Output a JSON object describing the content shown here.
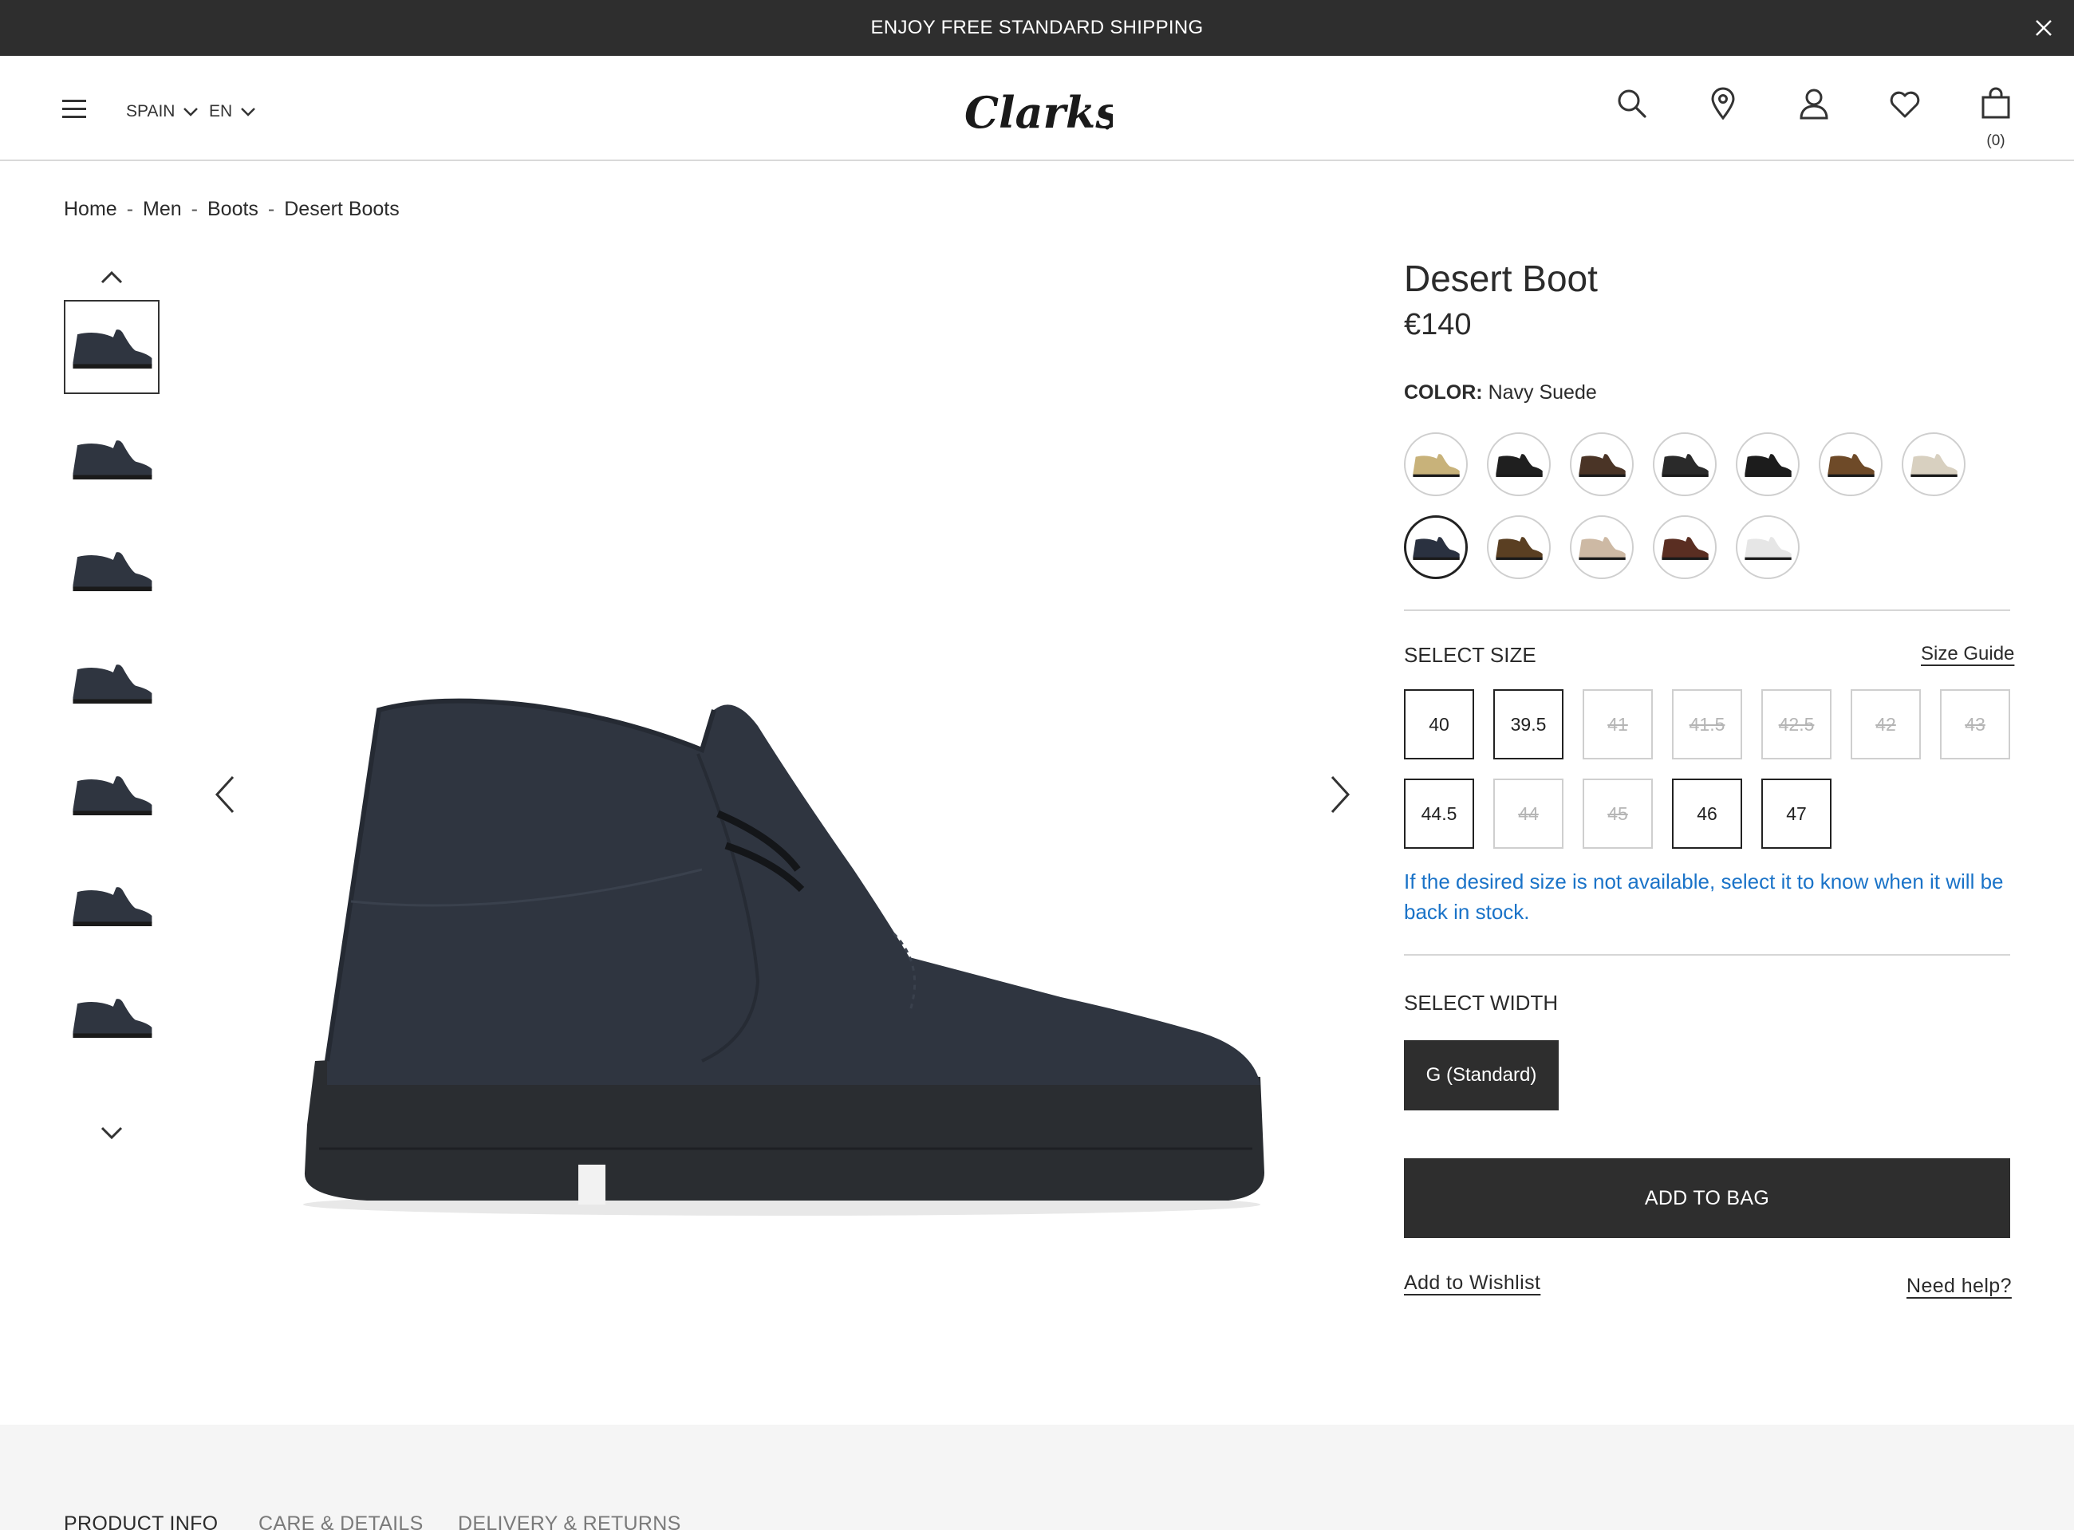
{
  "promo": {
    "text": "ENJOY FREE STANDARD SHIPPING"
  },
  "header": {
    "country": "SPAIN",
    "language": "EN",
    "logo_text": "Clarks",
    "bag_count": "(0)"
  },
  "breadcrumb": {
    "items": [
      "Home",
      "Men",
      "Boots",
      "Desert Boots"
    ],
    "separator": "-"
  },
  "product": {
    "title": "Desert Boot",
    "price": "€140",
    "color_label": "COLOR:",
    "color_value": "Navy Suede",
    "swatch_colors": [
      "#c8b27a",
      "#1f1f1f",
      "#4a3426",
      "#2a2a2a",
      "#1c1c1c",
      "#6e4a28",
      "#d8d0c0",
      "#2a3140",
      "#5a3f22",
      "#cdb9a4",
      "#5a2e22",
      "#e6e6e6"
    ],
    "selected_swatch_index": 7,
    "main_color": "#2f3540"
  },
  "size": {
    "label": "SELECT SIZE",
    "guide_link": "Size Guide",
    "options": [
      {
        "label": "40",
        "available": true
      },
      {
        "label": "39.5",
        "available": true
      },
      {
        "label": "41",
        "available": false
      },
      {
        "label": "41.5",
        "available": false
      },
      {
        "label": "42.5",
        "available": false
      },
      {
        "label": "42",
        "available": false
      },
      {
        "label": "43",
        "available": false
      },
      {
        "label": "44.5",
        "available": true
      },
      {
        "label": "44",
        "available": false
      },
      {
        "label": "45",
        "available": false
      },
      {
        "label": "46",
        "available": true
      },
      {
        "label": "47",
        "available": true
      }
    ],
    "stock_note": "If the desired size is not available, select it to know when it will be back in stock."
  },
  "width": {
    "label": "SELECT WIDTH",
    "option": "G (Standard)"
  },
  "actions": {
    "add_to_bag": "ADD TO BAG",
    "wishlist": "Add to Wishlist",
    "need_help": "Need help?"
  },
  "info_tabs": [
    "PRODUCT INFO",
    "CARE & DETAILS",
    "DELIVERY & RETURNS"
  ],
  "icons": {
    "promo_close": "close-icon",
    "menu": "hamburger-menu-icon",
    "search": "search-icon",
    "store": "location-pin-icon",
    "account": "user-icon",
    "wishlist": "heart-icon",
    "bag": "shopping-bag-icon"
  },
  "colors": {
    "dark": "#2e2e2e",
    "link_blue": "#1a73c8",
    "disabled": "#b5b5b5"
  }
}
